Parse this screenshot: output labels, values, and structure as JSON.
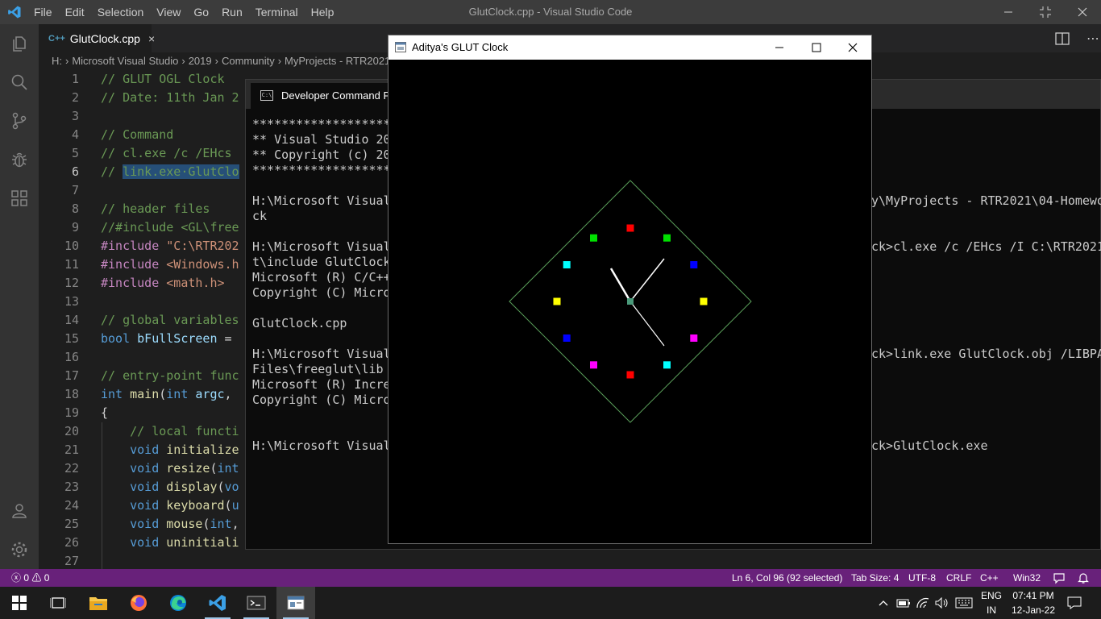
{
  "vscode": {
    "window_title": "GlutClock.cpp - Visual Studio Code",
    "menu": [
      "File",
      "Edit",
      "Selection",
      "View",
      "Go",
      "Run",
      "Terminal",
      "Help"
    ],
    "tab": {
      "lang_glyph": "C++",
      "label": "GlutClock.cpp",
      "close": "×"
    },
    "breadcrumb": [
      "H:",
      "Microsoft Visual Studio",
      "2019",
      "Community",
      "MyProjects - RTR2021"
    ],
    "activity_icons": [
      "explorer-icon",
      "search-icon",
      "source-control-icon",
      "debug-icon",
      "extensions-icon",
      "account-icon",
      "settings-gear-icon"
    ],
    "line_numbers": [
      "1",
      "2",
      "3",
      "4",
      "5",
      "6",
      "7",
      "8",
      "9",
      "10",
      "11",
      "12",
      "13",
      "14",
      "15",
      "16",
      "17",
      "18",
      "19",
      "20",
      "21",
      "22",
      "23",
      "24",
      "25",
      "26",
      "27"
    ],
    "code": {
      "l1": "// GLUT OGL Clock",
      "l2": "// Date: 11th Jan 2",
      "l4": "// Command",
      "l5": "// cl.exe /c /EHcs",
      "l6a": "// ",
      "l6b": "link.exe·GlutClo",
      "l8": "// header files",
      "l9": "//#include <GL\\free",
      "l10a": "#include ",
      "l10b": "\"C:\\RTR202",
      "l11a": "#include ",
      "l11b": "<Windows.h",
      "l12a": "#include ",
      "l12b": "<math.h>",
      "l14": "// global variables",
      "l15a": "bool ",
      "l15b": "bFullScreen",
      "l15c": " = ",
      "l17": "// entry-point func",
      "l18a": "int ",
      "l18b": "main",
      "l18c": "(",
      "l18d": "int ",
      "l18e": "argc",
      "l18f": ",",
      "l19": "{",
      "l20": "    // local functi",
      "l21a": "    void ",
      "l21b": "initialize",
      "l22a": "    void ",
      "l22b": "resize",
      "l22c": "(",
      "l22d": "int",
      "l23a": "    void ",
      "l23b": "display",
      "l23c": "(",
      "l23d": "vo",
      "l24a": "    void ",
      "l24b": "keyboard",
      "l24c": "(",
      "l24d": "u",
      "l25a": "    void ",
      "l25b": "mouse",
      "l25c": "(",
      "l25d": "int",
      "l25e": ",",
      "l26a": "    void ",
      "l26b": "uninitiali"
    },
    "status": {
      "errors": "0",
      "warnings": "0",
      "cursor": "Ln 6, Col 96 (92 selected)",
      "tab_size": "Tab Size: 4",
      "encoding": "UTF-8",
      "eol": "CRLF",
      "language": "C++",
      "platform": "Win32"
    },
    "colors": {
      "statusbar": "#68217a",
      "accent": "#007acc"
    }
  },
  "cmd": {
    "tab_title": "Developer Command Prompt",
    "icon_text": "C:\\",
    "left_lines": [
      "**********************",
      "** Visual Studio 20",
      "** Copyright (c) 20",
      "**********************",
      "",
      "H:\\Microsoft Visual",
      "ck",
      "",
      "H:\\Microsoft Visual",
      "t\\include GlutClock",
      "Microsoft (R) C/C++",
      "Copyright (C) Micro",
      "",
      "GlutClock.cpp",
      "",
      "H:\\Microsoft Visual",
      "Files\\freeglut\\lib",
      "Microsoft (R) Incre",
      "Copyright (C) Micro",
      "",
      "",
      "H:\\Microsoft Visual"
    ],
    "right_lines": [
      "",
      "",
      "",
      "",
      "",
      "y\\MyProjects - RTR2021\\04-Homewo",
      "",
      "",
      "ck>cl.exe /c /EHcs /I C:\\RTR2021",
      "",
      "",
      "",
      "",
      "",
      "",
      "ck>link.exe GlutClock.obj /LIBPA",
      "",
      "",
      "",
      "",
      "",
      "ck>GlutClock.exe"
    ]
  },
  "glut": {
    "title": "Aditya's GLUT Clock",
    "marker_colors": [
      "#ff0000",
      "#00e000",
      "#0000ff",
      "#ffff00",
      "#ff00ff",
      "#00ffff",
      "#ff0000",
      "#ff00ff",
      "#0000ff",
      "#ffff00",
      "#00ffff",
      "#00e000"
    ],
    "frame_color": "#5a9e5a",
    "hand_color": "#ffffff"
  },
  "taskbar": {
    "apps": [
      "start-icon",
      "task-view-icon",
      "file-explorer-icon",
      "firefox-icon",
      "edge-icon",
      "vscode-icon",
      "terminal-icon",
      "glut-app-icon"
    ],
    "lang_top": "ENG",
    "lang_bottom": "IN",
    "time": "07:41 PM",
    "date": "12-Jan-22"
  }
}
